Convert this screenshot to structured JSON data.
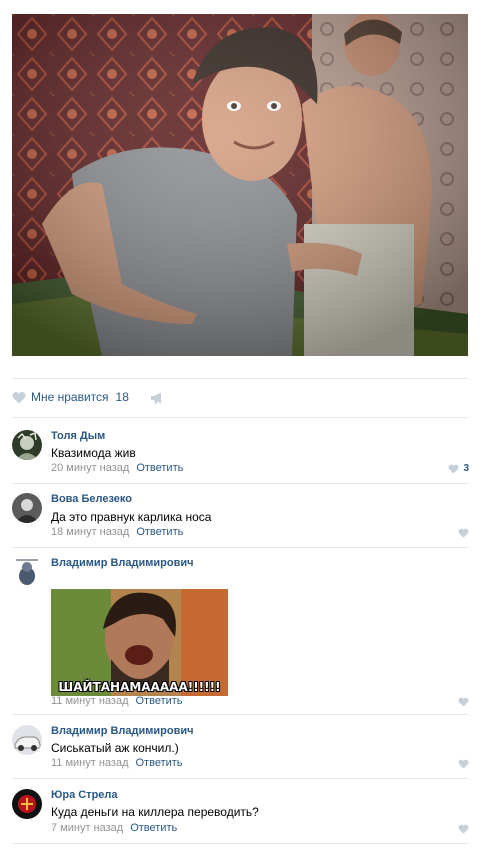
{
  "post": {
    "like_label": "Мне нравится",
    "like_count": "18"
  },
  "comments": [
    {
      "author": "Толя Дым",
      "text": "Квазимода жив",
      "time": "20 минут назад",
      "reply": "Ответить",
      "likes": "3"
    },
    {
      "author": "Вова Белезеко",
      "text": "Да это правнук карлика носа",
      "time": "18 минут назад",
      "reply": "Ответить",
      "likes": ""
    },
    {
      "author": "Владимир Владимирович",
      "attachment_caption": "ШАЙТАНАМААААА!!!!!!",
      "time": "11 минут назад",
      "reply": "Ответить",
      "likes": ""
    },
    {
      "author": "Владимир Владимирович",
      "text": "Сиськатый аж кончил.)",
      "time": "11 минут назад",
      "reply": "Ответить",
      "likes": ""
    },
    {
      "author": "Юра Стрела",
      "text": "Куда деньги на киллера переводить?",
      "time": "7 минут назад",
      "reply": "Ответить",
      "likes": ""
    }
  ],
  "colors": {
    "link": "#2a5885",
    "meta": "#939393",
    "divider": "#e7e8ec",
    "heart": "#c5d0db"
  },
  "icons": [
    "heart-icon",
    "megaphone-icon"
  ]
}
